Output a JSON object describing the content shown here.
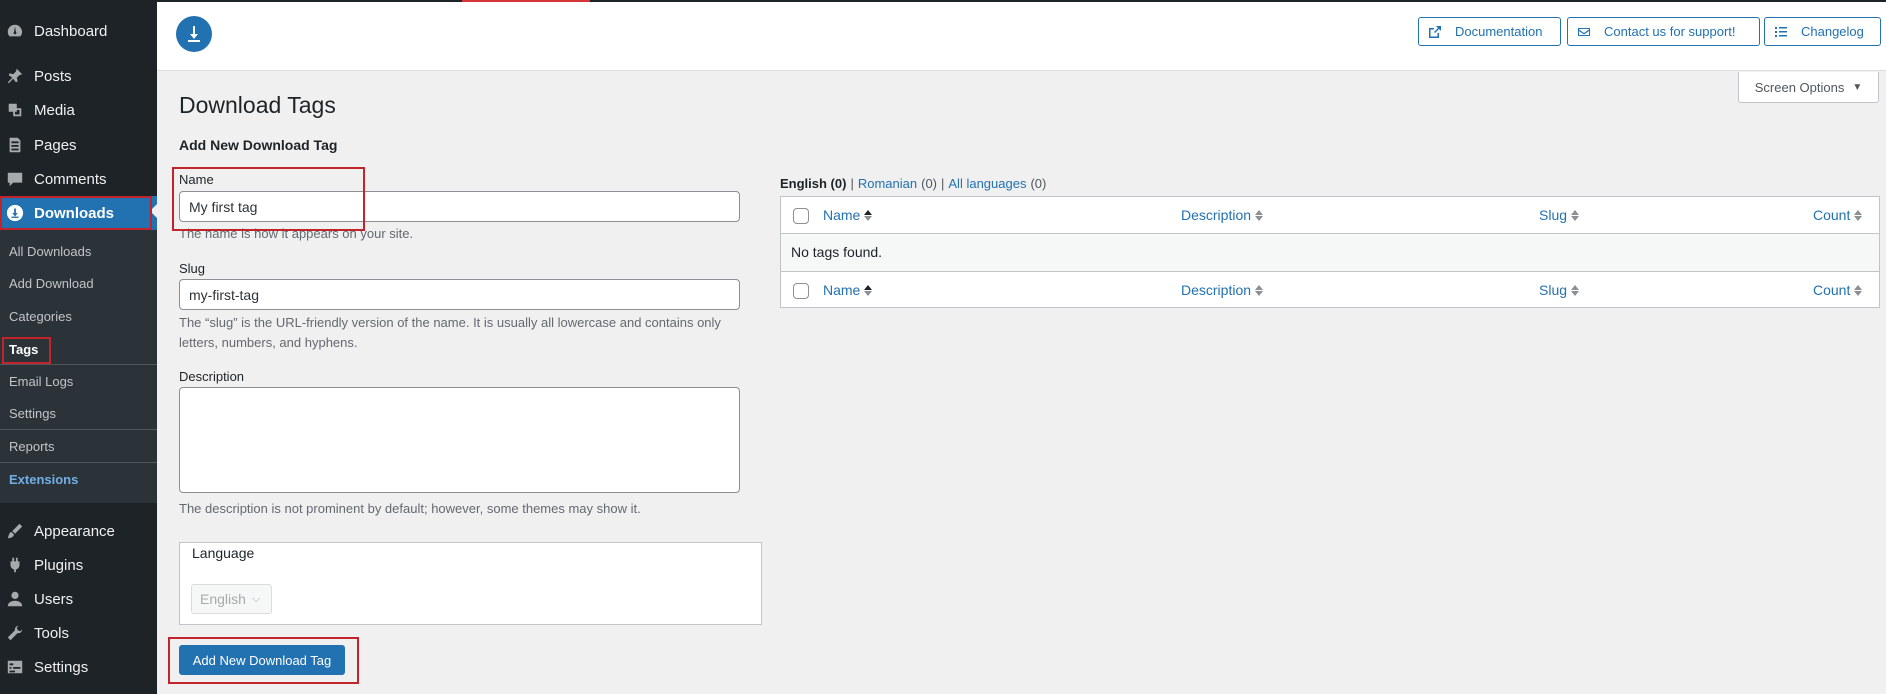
{
  "sidebar": {
    "top_items": [
      {
        "label": "Dashboard",
        "icon": "dashboard-icon"
      },
      {
        "label": "Posts",
        "icon": "pin-icon"
      },
      {
        "label": "Media",
        "icon": "media-icon"
      },
      {
        "label": "Pages",
        "icon": "page-icon"
      },
      {
        "label": "Comments",
        "icon": "comment-icon"
      },
      {
        "label": "Downloads",
        "icon": "download-icon"
      }
    ],
    "submenu": [
      "All Downloads",
      "Add Download",
      "Categories",
      "Tags",
      "Email Logs",
      "Settings",
      "Reports",
      "Extensions"
    ],
    "bottom_items": [
      {
        "label": "Appearance",
        "icon": "brush-icon"
      },
      {
        "label": "Plugins",
        "icon": "plug-icon"
      },
      {
        "label": "Users",
        "icon": "user-icon"
      },
      {
        "label": "Tools",
        "icon": "wrench-icon"
      },
      {
        "label": "Settings",
        "icon": "settings-icon"
      }
    ]
  },
  "header": {
    "documentation": "Documentation",
    "support": "Contact us for support!",
    "changelog": "Changelog"
  },
  "screen_options": "Screen Options",
  "page_title": "Download Tags",
  "form": {
    "heading": "Add New Download Tag",
    "name_label": "Name",
    "name_value": "My first tag",
    "name_help": "The name is how it appears on your site.",
    "slug_label": "Slug",
    "slug_value": "my-first-tag",
    "slug_help": "The “slug” is the URL-friendly version of the name. It is usually all lowercase and contains only letters, numbers, and hyphens.",
    "description_label": "Description",
    "description_help": "The description is not prominent by default; however, some themes may show it.",
    "language_title": "Language",
    "language_value": "English",
    "submit": "Add New Download Tag"
  },
  "table": {
    "filter_current": "English (0)",
    "filter_sep": "|",
    "filter_romanian": "Romanian",
    "filter_romanian_count": "(0)",
    "filter_all": "All languages",
    "filter_all_count": "(0)",
    "columns": [
      "Name",
      "Description",
      "Slug",
      "Count"
    ],
    "empty": "No tags found."
  },
  "colors": {
    "accent": "#2271b1",
    "sidebar": "#1d2327",
    "highlight": "#c3232a"
  }
}
